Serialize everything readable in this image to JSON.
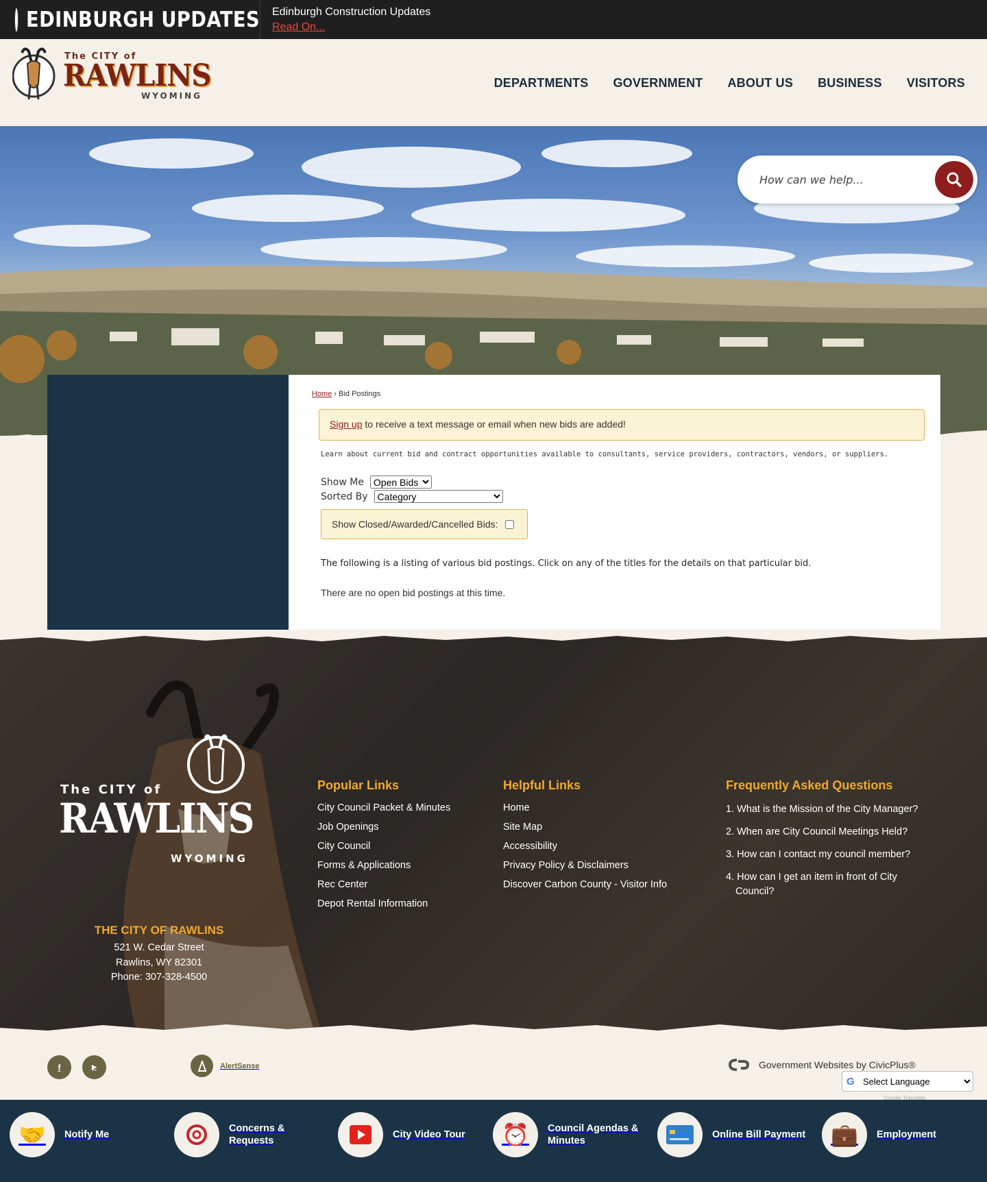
{
  "alert": {
    "heading": "EDINBURGH UPDATES",
    "title": "Edinburgh Construction Updates",
    "link": "Read On..."
  },
  "logo": {
    "small": "The CITY of",
    "big": "RAWLINS",
    "state": "WYOMING"
  },
  "nav": {
    "items": [
      "DEPARTMENTS",
      "GOVERNMENT",
      "ABOUT US",
      "BUSINESS",
      "VISITORS"
    ]
  },
  "search": {
    "placeholder": "How can we help..."
  },
  "breadcrumb": {
    "home": "Home",
    "separator": "›",
    "current": "Bid Postings"
  },
  "signup": {
    "link": "Sign up",
    "text": " to receive a text message or email when new bids are added!"
  },
  "learn": "Learn about current bid and contract opportunities available to consultants, service providers, contractors, vendors, or suppliers.",
  "controls": {
    "show_label": "Show Me",
    "show_value": "Open Bids",
    "sort_label": "Sorted By",
    "sort_value": "Category",
    "closed_label": "Show Closed/Awarded/Cancelled Bids:"
  },
  "listing": "The following is a listing of various bid postings. Click on any of the titles for the details on that particular bid.",
  "no_bids": "There are no open bid postings at this time.",
  "footer": {
    "logo_small": "The CITY of",
    "logo_big": "RAWLINS",
    "logo_state": "WYOMING",
    "city_name": "THE CITY OF RAWLINS",
    "address_line1": "521 W. Cedar Street",
    "address_line2": "Rawlins, WY 82301",
    "phone": "Phone: 307-328-4500",
    "popular": {
      "title": "Popular Links",
      "links": [
        "City Council Packet & Minutes",
        "Job Openings",
        "City Council",
        "Forms & Applications",
        "Rec Center",
        "Depot Rental Information"
      ]
    },
    "helpful": {
      "title": "Helpful Links",
      "links": [
        "Home",
        "Site Map",
        "Accessibility",
        "Privacy Policy & Disclaimers",
        "Discover Carbon County - Visitor Info"
      ]
    },
    "faq": {
      "title": "Frequently Asked Questions",
      "items": [
        "1. What is the Mission of the City Manager?",
        "2. When are City Council Meetings Held?",
        "3. How can I contact my council member?",
        "4. How can I get an item in front of City Council?"
      ]
    }
  },
  "bottom": {
    "facebook": "f",
    "youtube": "▶",
    "alertsense": "AlertSense",
    "civic": "Government Websites by CivicPlus®",
    "language": "Select Language",
    "google_g": "G",
    "powered": "Google Translate"
  },
  "quick_links": [
    {
      "label": "Notify Me",
      "icon": "handshake-icon"
    },
    {
      "label": "Concerns & Requests",
      "icon": "email-icon"
    },
    {
      "label": "City Video Tour",
      "icon": "play-icon"
    },
    {
      "label": "Council Agendas & Minutes",
      "icon": "alarm-clock-icon"
    },
    {
      "label": "Online Bill Payment",
      "icon": "credit-card-icon"
    },
    {
      "label": "Employment",
      "icon": "briefcase-icon"
    }
  ],
  "colors": {
    "accent": "#8f1d1d",
    "navy": "#1a3347",
    "gold": "#f0a92a",
    "alert_red": "#e8453c"
  }
}
